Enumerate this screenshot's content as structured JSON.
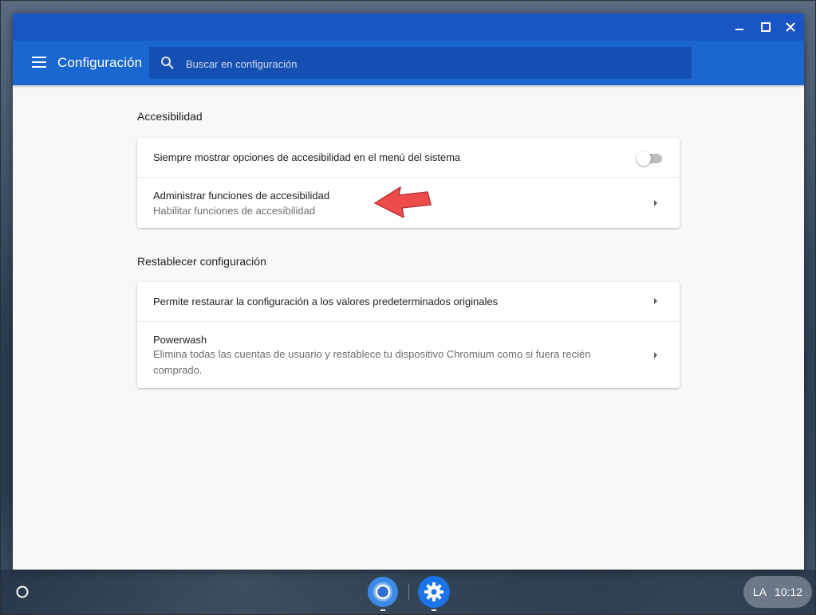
{
  "app": {
    "title": "Configuración"
  },
  "search": {
    "placeholder": "Buscar en configuración"
  },
  "sections": [
    {
      "title": "Accesibilidad",
      "rows": [
        {
          "label": "Siempre mostrar opciones de accesibilidad en el menú del sistema",
          "toggle": false
        },
        {
          "label": "Administrar funciones de accesibilidad",
          "sub": "Habilitar funciones de accesibilidad"
        }
      ]
    },
    {
      "title": "Restablecer configuración",
      "rows": [
        {
          "label": "Permite restaurar la configuración a los valores predeterminados originales"
        },
        {
          "label": "Powerwash",
          "sub": "Elimina todas las cuentas de usuario y restablece tu dispositivo Chromium como si fuera recién comprado."
        }
      ]
    }
  ],
  "shelf": {
    "apps": [
      "chromium-browser-icon",
      "settings-gear-icon"
    ],
    "status": {
      "ime": "LA",
      "time": "10:12"
    }
  },
  "colors": {
    "titlebar": "#1a55c6",
    "toolbar": "#1a67d2",
    "search_bg": "#1450b2",
    "annotation_arrow": "#ee4b4b"
  }
}
